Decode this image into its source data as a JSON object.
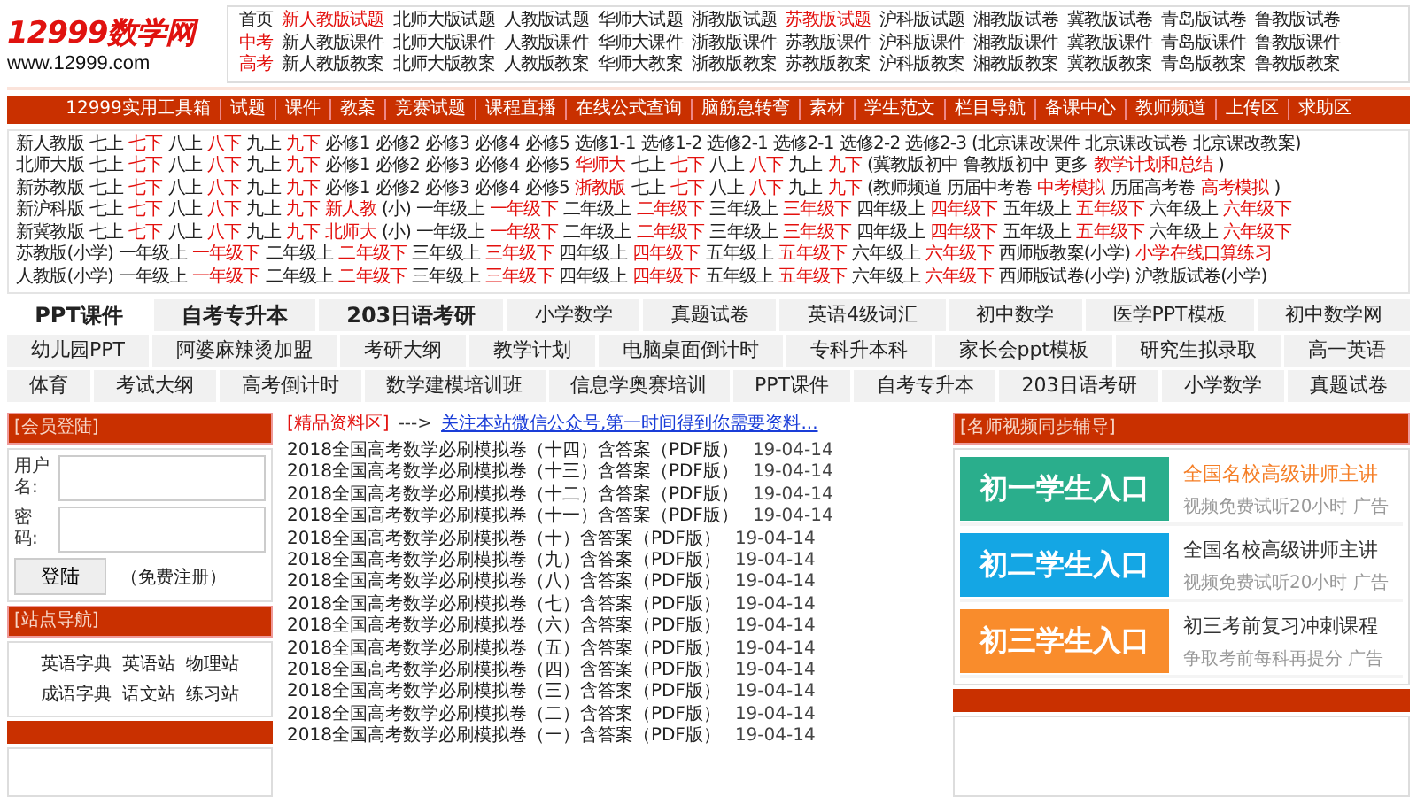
{
  "logo": {
    "name": "12999数学网",
    "url": "www.12999.com"
  },
  "top_links": [
    {
      "items": [
        {
          "text": "首页",
          "highlight": false
        },
        {
          "text": "新人教版试题",
          "highlight": true
        },
        {
          "text": "北师大版试题",
          "highlight": false
        },
        {
          "text": "人教版试题",
          "highlight": false
        },
        {
          "text": "华师大试题",
          "highlight": false
        },
        {
          "text": "浙教版试题",
          "highlight": false
        },
        {
          "text": "苏教版试题",
          "highlight": true
        },
        {
          "text": "沪科版试题",
          "highlight": false
        },
        {
          "text": "湘教版试卷",
          "highlight": false
        },
        {
          "text": "冀教版试卷",
          "highlight": false
        },
        {
          "text": "青岛版试卷",
          "highlight": false
        },
        {
          "text": "鲁教版试卷",
          "highlight": false
        }
      ]
    },
    {
      "items": [
        {
          "text": "中考",
          "highlight": true
        },
        {
          "text": "新人教版课件",
          "highlight": false
        },
        {
          "text": "北师大版课件",
          "highlight": false
        },
        {
          "text": "人教版课件",
          "highlight": false
        },
        {
          "text": "华师大课件",
          "highlight": false
        },
        {
          "text": "浙教版课件",
          "highlight": false
        },
        {
          "text": "苏教版课件",
          "highlight": false
        },
        {
          "text": "沪科版课件",
          "highlight": false
        },
        {
          "text": "湘教版课件",
          "highlight": false
        },
        {
          "text": "冀教版课件",
          "highlight": false
        },
        {
          "text": "青岛版课件",
          "highlight": false
        },
        {
          "text": "鲁教版课件",
          "highlight": false
        }
      ]
    },
    {
      "items": [
        {
          "text": "高考",
          "highlight": true
        },
        {
          "text": "新人教版教案",
          "highlight": false
        },
        {
          "text": "北师大版教案",
          "highlight": false
        },
        {
          "text": "人教版教案",
          "highlight": false
        },
        {
          "text": "华师大教案",
          "highlight": false
        },
        {
          "text": "浙教版教案",
          "highlight": false
        },
        {
          "text": "苏教版教案",
          "highlight": false
        },
        {
          "text": "沪科版教案",
          "highlight": false
        },
        {
          "text": "湘教版教案",
          "highlight": false
        },
        {
          "text": "冀教版教案",
          "highlight": false
        },
        {
          "text": "青岛版教案",
          "highlight": false
        },
        {
          "text": "鲁教版教案",
          "highlight": false
        }
      ]
    }
  ],
  "nav": [
    "12999实用工具箱",
    "试题",
    "课件",
    "教案",
    "竞赛试题",
    "课程直播",
    "在线公式查询",
    "脑筋急转弯",
    "素材",
    "学生范文",
    "栏目导航",
    "备课中心",
    "教师频道",
    "上传区",
    "求助区"
  ],
  "grade_rows": [
    {
      "items": [
        {
          "text": "新人教版",
          "highlight": false
        },
        {
          "text": "七上",
          "highlight": false
        },
        {
          "text": "七下",
          "highlight": true
        },
        {
          "text": "八上",
          "highlight": false
        },
        {
          "text": "八下",
          "highlight": true
        },
        {
          "text": "九上",
          "highlight": false
        },
        {
          "text": "九下",
          "highlight": true
        },
        {
          "text": "必修1",
          "highlight": false
        },
        {
          "text": "必修2",
          "highlight": false
        },
        {
          "text": "必修3",
          "highlight": false
        },
        {
          "text": "必修4",
          "highlight": false
        },
        {
          "text": "必修5",
          "highlight": false
        },
        {
          "text": "选修1-1",
          "highlight": false
        },
        {
          "text": "选修1-2",
          "highlight": false
        },
        {
          "text": "选修2-1",
          "highlight": false
        },
        {
          "text": "选修2-1",
          "highlight": false
        },
        {
          "text": "选修2-2",
          "highlight": false
        },
        {
          "text": "选修2-3",
          "highlight": false
        },
        {
          "text": "(北京课改课件",
          "highlight": false
        },
        {
          "text": "北京课改试卷",
          "highlight": false
        },
        {
          "text": "北京课改教案)",
          "highlight": false
        }
      ]
    },
    {
      "items": [
        {
          "text": "北师大版",
          "highlight": false
        },
        {
          "text": "七上",
          "highlight": false
        },
        {
          "text": "七下",
          "highlight": true
        },
        {
          "text": "八上",
          "highlight": false
        },
        {
          "text": "八下",
          "highlight": true
        },
        {
          "text": "九上",
          "highlight": false
        },
        {
          "text": "九下",
          "highlight": true
        },
        {
          "text": "必修1",
          "highlight": false
        },
        {
          "text": "必修2",
          "highlight": false
        },
        {
          "text": "必修3",
          "highlight": false
        },
        {
          "text": "必修4",
          "highlight": false
        },
        {
          "text": "必修5",
          "highlight": false
        },
        {
          "text": "华师大",
          "highlight": true
        },
        {
          "text": "七上",
          "highlight": false
        },
        {
          "text": "七下",
          "highlight": true
        },
        {
          "text": "八上",
          "highlight": false
        },
        {
          "text": "八下",
          "highlight": true
        },
        {
          "text": "九上",
          "highlight": false
        },
        {
          "text": "九下",
          "highlight": true
        },
        {
          "text": "(冀教版初中",
          "highlight": false
        },
        {
          "text": "鲁教版初中",
          "highlight": false
        },
        {
          "text": "更多",
          "highlight": false
        },
        {
          "text": "教学计划和总结",
          "highlight": true
        },
        {
          "text": ")",
          "highlight": false
        }
      ]
    },
    {
      "items": [
        {
          "text": "新苏教版",
          "highlight": false
        },
        {
          "text": "七上",
          "highlight": false
        },
        {
          "text": "七下",
          "highlight": true
        },
        {
          "text": "八上",
          "highlight": false
        },
        {
          "text": "八下",
          "highlight": true
        },
        {
          "text": "九上",
          "highlight": false
        },
        {
          "text": "九下",
          "highlight": true
        },
        {
          "text": "必修1",
          "highlight": false
        },
        {
          "text": "必修2",
          "highlight": false
        },
        {
          "text": "必修3",
          "highlight": false
        },
        {
          "text": "必修4",
          "highlight": false
        },
        {
          "text": "必修5",
          "highlight": false
        },
        {
          "text": "浙教版",
          "highlight": true
        },
        {
          "text": "七上",
          "highlight": false
        },
        {
          "text": "七下",
          "highlight": true
        },
        {
          "text": "八上",
          "highlight": false
        },
        {
          "text": "八下",
          "highlight": true
        },
        {
          "text": "九上",
          "highlight": false
        },
        {
          "text": "九下",
          "highlight": true
        },
        {
          "text": "(教师频道",
          "highlight": false
        },
        {
          "text": "历届中考卷",
          "highlight": false
        },
        {
          "text": "中考模拟",
          "highlight": true
        },
        {
          "text": "历届高考卷",
          "highlight": false
        },
        {
          "text": "高考模拟",
          "highlight": true
        },
        {
          "text": ")",
          "highlight": false
        }
      ]
    },
    {
      "items": [
        {
          "text": "新沪科版",
          "highlight": false
        },
        {
          "text": "七上",
          "highlight": false
        },
        {
          "text": "七下",
          "highlight": true
        },
        {
          "text": "八上",
          "highlight": false
        },
        {
          "text": "八下",
          "highlight": true
        },
        {
          "text": "九上",
          "highlight": false
        },
        {
          "text": "九下",
          "highlight": true
        },
        {
          "text": "新人教",
          "highlight": true
        },
        {
          "text": "(小)",
          "highlight": false
        },
        {
          "text": "一年级上",
          "highlight": false
        },
        {
          "text": "一年级下",
          "highlight": true
        },
        {
          "text": "二年级上",
          "highlight": false
        },
        {
          "text": "二年级下",
          "highlight": true
        },
        {
          "text": "三年级上",
          "highlight": false
        },
        {
          "text": "三年级下",
          "highlight": true
        },
        {
          "text": "四年级上",
          "highlight": false
        },
        {
          "text": "四年级下",
          "highlight": true
        },
        {
          "text": "五年级上",
          "highlight": false
        },
        {
          "text": "五年级下",
          "highlight": true
        },
        {
          "text": "六年级上",
          "highlight": false
        },
        {
          "text": "六年级下",
          "highlight": true
        }
      ]
    },
    {
      "items": [
        {
          "text": "新冀教版",
          "highlight": false
        },
        {
          "text": "七上",
          "highlight": false
        },
        {
          "text": "七下",
          "highlight": true
        },
        {
          "text": "八上",
          "highlight": false
        },
        {
          "text": "八下",
          "highlight": true
        },
        {
          "text": "九上",
          "highlight": false
        },
        {
          "text": "九下",
          "highlight": true
        },
        {
          "text": "北师大",
          "highlight": true
        },
        {
          "text": "(小)",
          "highlight": false
        },
        {
          "text": "一年级上",
          "highlight": false
        },
        {
          "text": "一年级下",
          "highlight": true
        },
        {
          "text": "二年级上",
          "highlight": false
        },
        {
          "text": "二年级下",
          "highlight": true
        },
        {
          "text": "三年级上",
          "highlight": false
        },
        {
          "text": "三年级下",
          "highlight": true
        },
        {
          "text": "四年级上",
          "highlight": false
        },
        {
          "text": "四年级下",
          "highlight": true
        },
        {
          "text": "五年级上",
          "highlight": false
        },
        {
          "text": "五年级下",
          "highlight": true
        },
        {
          "text": "六年级上",
          "highlight": false
        },
        {
          "text": "六年级下",
          "highlight": true
        }
      ]
    },
    {
      "items": [
        {
          "text": "苏教版(小学)",
          "highlight": false
        },
        {
          "text": "一年级上",
          "highlight": false
        },
        {
          "text": "一年级下",
          "highlight": true
        },
        {
          "text": "二年级上",
          "highlight": false
        },
        {
          "text": "二年级下",
          "highlight": true
        },
        {
          "text": "三年级上",
          "highlight": false
        },
        {
          "text": "三年级下",
          "highlight": true
        },
        {
          "text": "四年级上",
          "highlight": false
        },
        {
          "text": "四年级下",
          "highlight": true
        },
        {
          "text": "五年级上",
          "highlight": false
        },
        {
          "text": "五年级下",
          "highlight": true
        },
        {
          "text": "六年级上",
          "highlight": false
        },
        {
          "text": "六年级下",
          "highlight": true
        },
        {
          "text": "西师版教案(小学)",
          "highlight": false
        },
        {
          "text": "小学在线口算练习",
          "highlight": true
        }
      ]
    },
    {
      "items": [
        {
          "text": "人教版(小学)",
          "highlight": false
        },
        {
          "text": "一年级上",
          "highlight": false
        },
        {
          "text": "一年级下",
          "highlight": true
        },
        {
          "text": "二年级上",
          "highlight": false
        },
        {
          "text": "二年级下",
          "highlight": true
        },
        {
          "text": "三年级上",
          "highlight": false
        },
        {
          "text": "三年级下",
          "highlight": true
        },
        {
          "text": "四年级上",
          "highlight": false
        },
        {
          "text": "四年级下",
          "highlight": true
        },
        {
          "text": "五年级上",
          "highlight": false
        },
        {
          "text": "五年级下",
          "highlight": true
        },
        {
          "text": "六年级上",
          "highlight": false
        },
        {
          "text": "六年级下",
          "highlight": true
        },
        {
          "text": "西师版试卷(小学)",
          "highlight": false
        },
        {
          "text": "沪教版试卷(小学)",
          "highlight": false
        }
      ]
    }
  ],
  "keyword_rows": [
    {
      "items": [
        {
          "text": "PPT课件",
          "bold": true,
          "selected": true
        },
        {
          "text": "自考专升本",
          "bold": true,
          "selected": false
        },
        {
          "text": "203日语考研",
          "bold": true,
          "selected": false
        },
        {
          "text": "小学数学",
          "bold": false,
          "selected": false
        },
        {
          "text": "真题试卷",
          "bold": false,
          "selected": false
        },
        {
          "text": "英语4级词汇",
          "bold": false,
          "selected": false
        },
        {
          "text": "初中数学",
          "bold": false,
          "selected": false
        },
        {
          "text": "医学PPT模板",
          "bold": false,
          "selected": false
        },
        {
          "text": "初中数学网",
          "bold": false,
          "selected": false
        }
      ]
    },
    {
      "items": [
        {
          "text": "幼儿园PPT",
          "bold": false,
          "selected": false
        },
        {
          "text": "阿婆麻辣烫加盟",
          "bold": false,
          "selected": false
        },
        {
          "text": "考研大纲",
          "bold": false,
          "selected": false
        },
        {
          "text": "教学计划",
          "bold": false,
          "selected": false
        },
        {
          "text": "电脑桌面倒计时",
          "bold": false,
          "selected": false
        },
        {
          "text": "专科升本科",
          "bold": false,
          "selected": false
        },
        {
          "text": "家长会ppt模板",
          "bold": false,
          "selected": false
        },
        {
          "text": "研究生拟录取",
          "bold": false,
          "selected": false
        },
        {
          "text": "高一英语",
          "bold": false,
          "selected": false
        }
      ]
    },
    {
      "items": [
        {
          "text": "体育",
          "bold": false,
          "selected": false
        },
        {
          "text": "考试大纲",
          "bold": false,
          "selected": false
        },
        {
          "text": "高考倒计时",
          "bold": false,
          "selected": false
        },
        {
          "text": "数学建模培训班",
          "bold": false,
          "selected": false
        },
        {
          "text": "信息学奥赛培训",
          "bold": false,
          "selected": false
        },
        {
          "text": "PPT课件",
          "bold": false,
          "selected": false
        },
        {
          "text": "自考专升本",
          "bold": false,
          "selected": false
        },
        {
          "text": "203日语考研",
          "bold": false,
          "selected": false
        },
        {
          "text": "小学数学",
          "bold": false,
          "selected": false
        },
        {
          "text": "真题试卷",
          "bold": false,
          "selected": false
        }
      ]
    }
  ],
  "login": {
    "title": "[会员登陆]",
    "username_label": "用户名:",
    "password_label": "密码:",
    "submit": "登陆",
    "register": "（免费注册）"
  },
  "site_nav": {
    "title": "[站点导航]",
    "links": [
      "英语字典",
      "英语站",
      "物理站",
      "成语字典",
      "语文站",
      "练习站"
    ]
  },
  "featured": {
    "title": "[精品资料区]",
    "arrow": "--->",
    "link": "关注本站微信公众号,第一时间得到你需要资料...",
    "items": [
      {
        "title": "2018全国高考数学必刷模拟卷（十四）含答案（PDF版）",
        "date": "19-04-14"
      },
      {
        "title": "2018全国高考数学必刷模拟卷（十三）含答案（PDF版）",
        "date": "19-04-14"
      },
      {
        "title": "2018全国高考数学必刷模拟卷（十二）含答案（PDF版）",
        "date": "19-04-14"
      },
      {
        "title": "2018全国高考数学必刷模拟卷（十一）含答案（PDF版）",
        "date": "19-04-14"
      },
      {
        "title": "2018全国高考数学必刷模拟卷（十）含答案（PDF版）",
        "date": "19-04-14"
      },
      {
        "title": "2018全国高考数学必刷模拟卷（九）含答案（PDF版）",
        "date": "19-04-14"
      },
      {
        "title": "2018全国高考数学必刷模拟卷（八）含答案（PDF版）",
        "date": "19-04-14"
      },
      {
        "title": "2018全国高考数学必刷模拟卷（七）含答案（PDF版）",
        "date": "19-04-14"
      },
      {
        "title": "2018全国高考数学必刷模拟卷（六）含答案（PDF版）",
        "date": "19-04-14"
      },
      {
        "title": "2018全国高考数学必刷模拟卷（五）含答案（PDF版）",
        "date": "19-04-14"
      },
      {
        "title": "2018全国高考数学必刷模拟卷（四）含答案（PDF版）",
        "date": "19-04-14"
      },
      {
        "title": "2018全国高考数学必刷模拟卷（三）含答案（PDF版）",
        "date": "19-04-14"
      },
      {
        "title": "2018全国高考数学必刷模拟卷（二）含答案（PDF版）",
        "date": "19-04-14"
      },
      {
        "title": "2018全国高考数学必刷模拟卷（一）含答案（PDF版）",
        "date": "19-04-14"
      }
    ]
  },
  "video": {
    "title": "[名师视频同步辅导]",
    "entries": [
      {
        "label": "初一学生入口",
        "color": "#2aae8c",
        "headline": "全国名校高级讲师主讲",
        "highlight": true,
        "subtitle": "视频免费试听20小时 广告"
      },
      {
        "label": "初二学生入口",
        "color": "#14a6e4",
        "headline": "全国名校高级讲师主讲",
        "highlight": false,
        "subtitle": "视频免费试听20小时 广告"
      },
      {
        "label": "初三学生入口",
        "color": "#f98c2c",
        "headline": "初三考前复习冲刺课程",
        "highlight": false,
        "subtitle": "争取考前每科再提分 广告"
      }
    ]
  }
}
